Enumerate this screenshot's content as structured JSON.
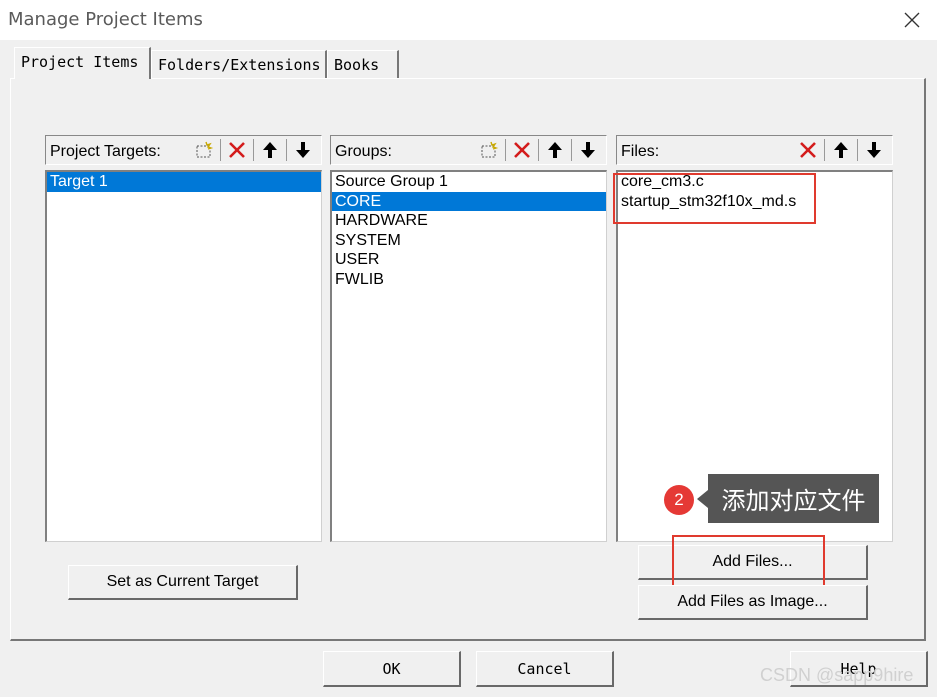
{
  "window": {
    "title": "Manage Project Items",
    "close_icon": "close-icon"
  },
  "tabs": [
    {
      "label": "Project Items",
      "active": true
    },
    {
      "label": "Folders/Extensions",
      "active": false
    },
    {
      "label": "Books",
      "active": false
    }
  ],
  "targets": {
    "label": "Project Targets:",
    "toolbar": [
      "new-icon",
      "delete-icon",
      "move-up-icon",
      "move-down-icon"
    ],
    "items": [
      "Target 1"
    ],
    "selected_index": 0
  },
  "groups": {
    "label": "Groups:",
    "toolbar": [
      "new-icon",
      "delete-icon",
      "move-up-icon",
      "move-down-icon"
    ],
    "items": [
      "Source Group 1",
      "CORE",
      "HARDWARE",
      "SYSTEM",
      "USER",
      "FWLIB"
    ],
    "selected_index": 1
  },
  "files": {
    "label": "Files:",
    "toolbar": [
      "delete-icon",
      "move-up-icon",
      "move-down-icon"
    ],
    "items": [
      "core_cm3.c",
      "startup_stm32f10x_md.s"
    ]
  },
  "buttons": {
    "set_current_target": "Set as Current Target",
    "add_files": "Add Files...",
    "add_files_image": "Add Files as Image...",
    "ok": "OK",
    "cancel": "Cancel",
    "help": "Help"
  },
  "annotation": {
    "step": "2",
    "text": "添加对应文件"
  },
  "watermark": "CSDN @sapp9hire",
  "colors": {
    "selection": "#0078d7",
    "highlight_box": "#e03a2e",
    "badge": "#e53935",
    "tooltip": "#555555"
  }
}
